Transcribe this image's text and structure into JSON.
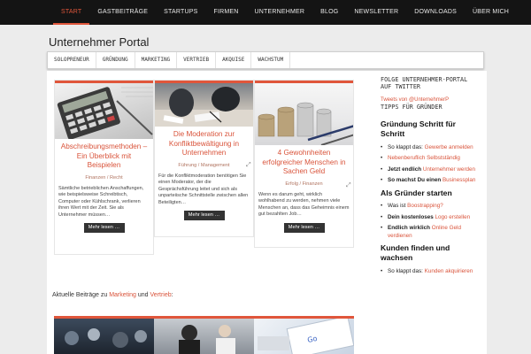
{
  "nav": [
    {
      "label": "START",
      "active": true
    },
    {
      "label": "GASTBEITRÄGE"
    },
    {
      "label": "STARTUPS"
    },
    {
      "label": "FIRMEN"
    },
    {
      "label": "UNTERNEHMER"
    },
    {
      "label": "BLOG"
    },
    {
      "label": "NEWSLETTER"
    },
    {
      "label": "DOWNLOADS"
    },
    {
      "label": "ÜBER MICH"
    }
  ],
  "site_title": "Unternehmer Portal",
  "categories": [
    "SOLOPRENEUR",
    "GRÜNDUNG",
    "MARKETING",
    "VERTRIEB",
    "AKQUISE",
    "WACHSTUM"
  ],
  "cards": [
    {
      "title": "Abschreibungsmethoden – Ein Überblick mit Beispielen",
      "meta": "Finanzen / Recht",
      "excerpt": "Sämtliche betrieblichen Anschaffungen, wie beispielsweise Schreibtisch, Computer oder Kühlschrank, verlieren ihren Wert mit der Zeit. Sie als Unternehmer müssen…",
      "button": "Mehr lesen …"
    },
    {
      "title": "Die Moderation zur Konfliktbewältigung in Unternehmen",
      "meta": "Führung / Management",
      "excerpt": "Für die Konfliktmoderation benötigen Sie einen Moderator, der die Gesprächsführung leitet und sich als unparteiische Schnittstelle zwischen allen Beteiligten…",
      "button": "Mehr lesen …"
    },
    {
      "title": "4 Gewohnheiten erfolgreicher Menschen in Sachen Geld",
      "meta": "Erfolg / Finanzen",
      "excerpt": "Wenn es darum geht, wirklich wohlhabend zu werden, nehmen viele Menschen an, dass das Geheimnis einem gut bezahlten Job…",
      "button": "Mehr lesen …"
    }
  ],
  "aktuell": {
    "prefix": "Aktuelle Beiträge zu ",
    "link1": "Marketing",
    "mid": " und ",
    "link2": "Vertrieb",
    "suffix": ":"
  },
  "sidebar": {
    "follow": "FOLGE UNTERNEHMER-PORTAL AUF TWITTER",
    "tweets": "Tweets von @UnternehmerP",
    "tipps": "TIPPS FÜR GRÜNDER",
    "sections": [
      {
        "heading": "Gründung Schritt für Schritt",
        "items": [
          {
            "a": "So klappt das: ",
            "b": "Gewerbe anmelden",
            "bold": false
          },
          {
            "a": "",
            "b": "Nebenberuflich Selbstständig",
            "bold": false
          },
          {
            "a": "Jetzt endlich ",
            "b": "Unternehmer werden",
            "bold": true
          },
          {
            "a": "So machst Du einen ",
            "b": "Businessplan",
            "bold": true
          }
        ]
      },
      {
        "heading": "Als Gründer starten",
        "items": [
          {
            "a": "Was ist ",
            "b": "Boostrapping?",
            "bold": false
          },
          {
            "a": "Dein kostenloses ",
            "b": "Logo erstellen",
            "bold": true
          },
          {
            "a": "Endlich wirklich ",
            "b": "Online Geld verdienen",
            "bold": true
          }
        ]
      },
      {
        "heading": "Kunden finden und wachsen",
        "items": [
          {
            "a": "So klappt das: ",
            "b": "Kunden akquirieren",
            "bold": false
          }
        ]
      }
    ]
  },
  "colors": {
    "accent": "#e0563b",
    "nav_bg": "#141414"
  },
  "icons": {
    "expand": "expand-icon"
  }
}
